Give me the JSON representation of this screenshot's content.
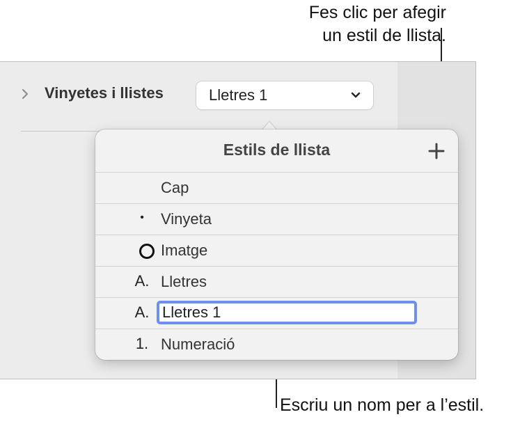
{
  "callouts": {
    "top_line1": "Fes clic per afegir",
    "top_line2": "un estil de llista.",
    "bottom": "Escriu un nom per a l’estil."
  },
  "inspector": {
    "section_label": "Vinyetes i llistes",
    "style_select_value": "Lletres 1"
  },
  "popover": {
    "title": "Estils de llista",
    "add_icon": "plus-icon",
    "rows": [
      {
        "marker": "",
        "label": "Cap"
      },
      {
        "marker": "•",
        "label": "Vinyeta"
      },
      {
        "marker": "ring-icon",
        "label": "Imatge"
      },
      {
        "marker": "A.",
        "label": "Lletres"
      },
      {
        "marker": "A.",
        "label": "Lletres 1"
      },
      {
        "marker": "1.",
        "label": "Numeració"
      }
    ],
    "edit_accent": "#6d8ff0"
  }
}
